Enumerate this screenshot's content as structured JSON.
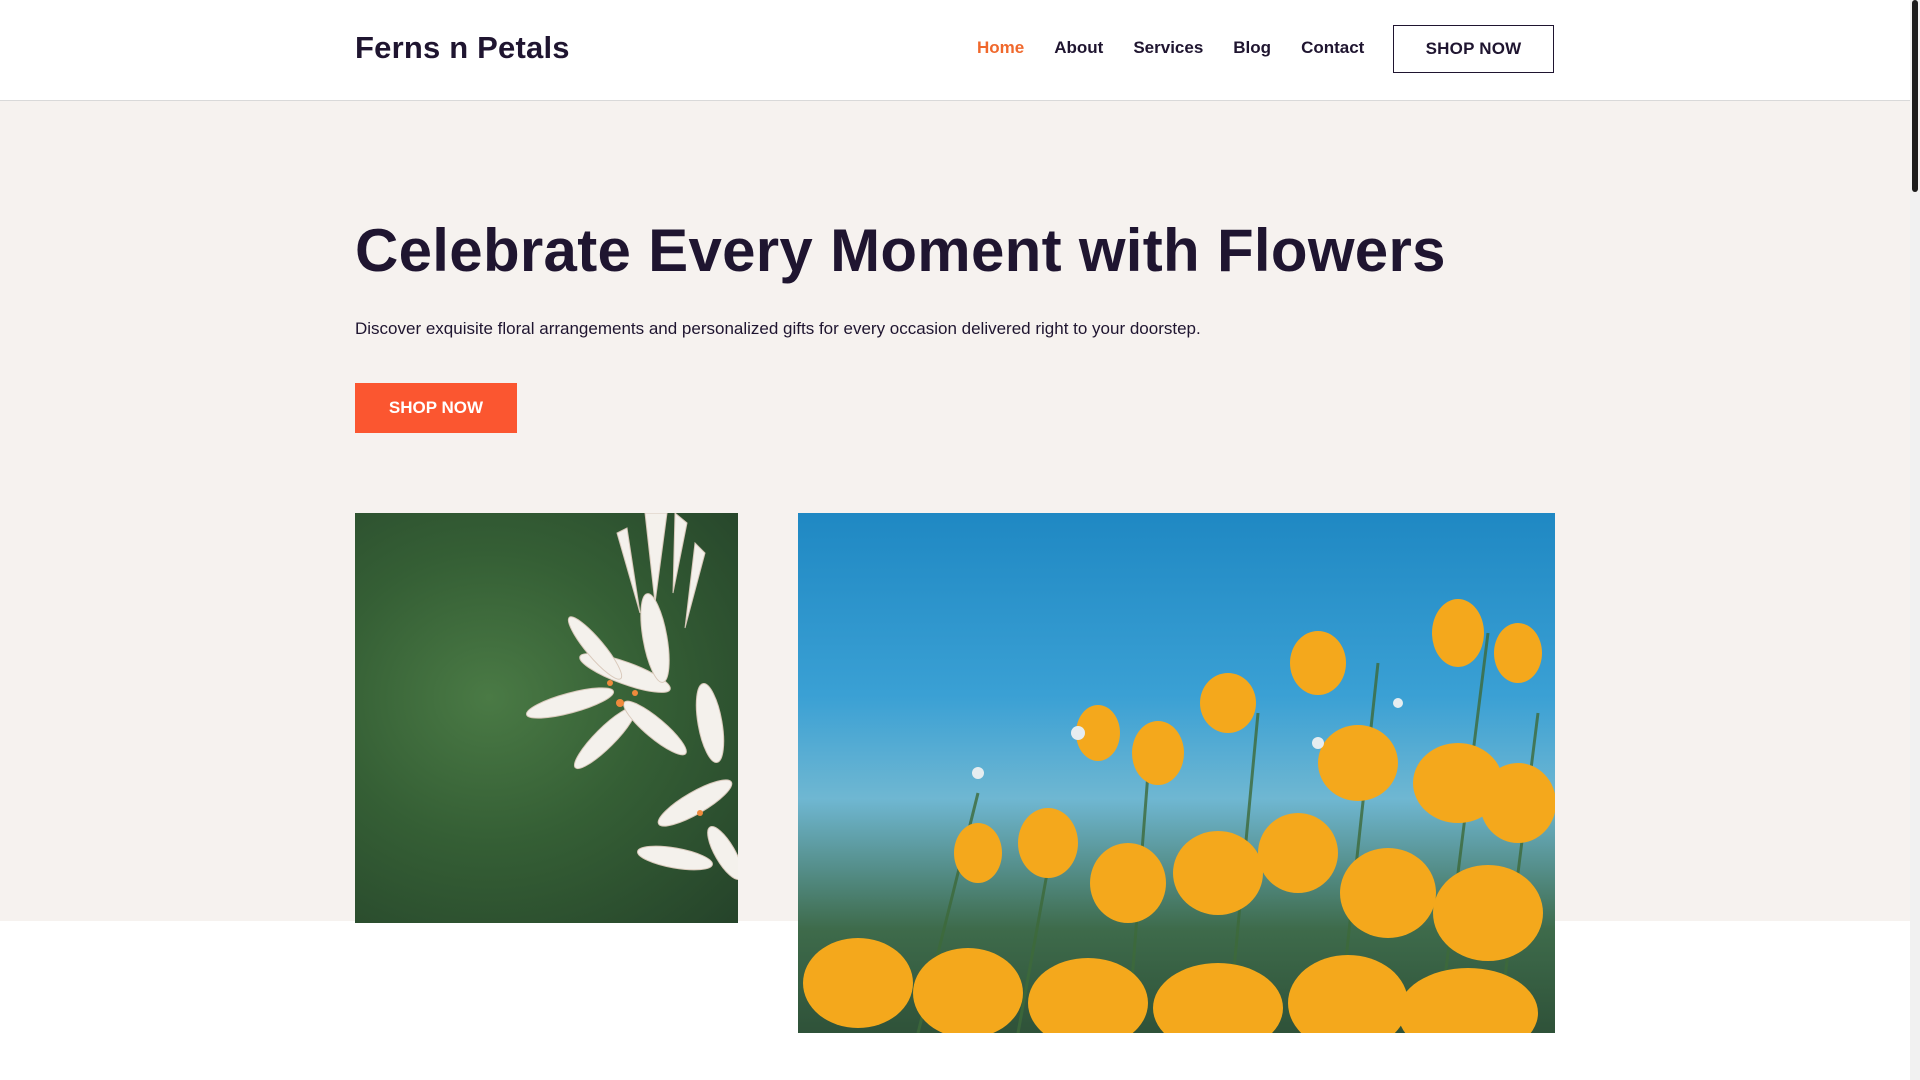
{
  "header": {
    "logo": "Ferns n Petals",
    "nav": [
      {
        "label": "Home",
        "active": true
      },
      {
        "label": "About",
        "active": false
      },
      {
        "label": "Services",
        "active": false
      },
      {
        "label": "Blog",
        "active": false
      },
      {
        "label": "Contact",
        "active": false
      }
    ],
    "cta_label": "SHOP NOW"
  },
  "hero": {
    "title": "Celebrate Every Moment with Flowers",
    "subtitle": "Discover exquisite floral arrangements and personalized gifts for every occasion delivered right to your doorstep.",
    "cta_label": "SHOP NOW"
  },
  "colors": {
    "accent": "#fb5630",
    "nav_active": "#f0682c",
    "text": "#1f1530",
    "hero_bg": "#f6f2ef"
  }
}
